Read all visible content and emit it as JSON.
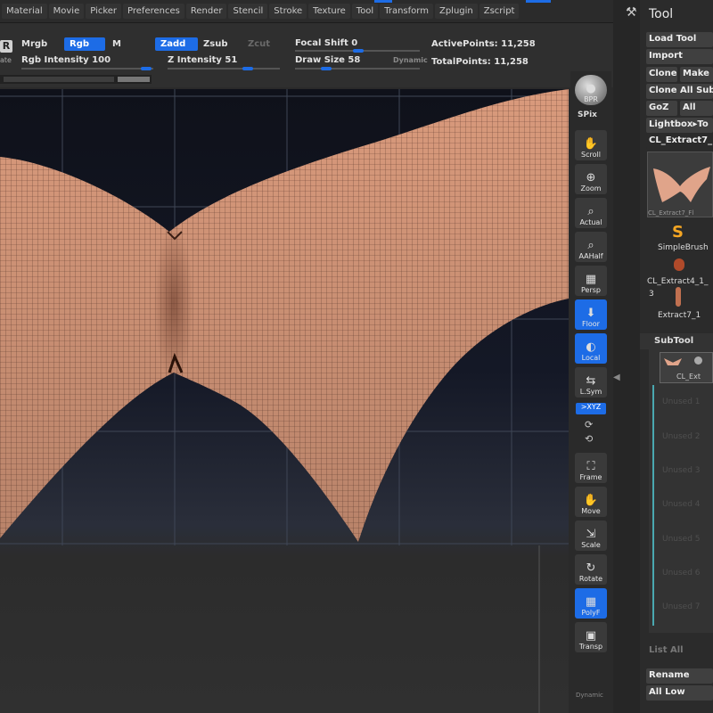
{
  "menu": [
    "Material",
    "Movie",
    "Picker",
    "Preferences",
    "Render",
    "Stencil",
    "Stroke",
    "Texture",
    "Tool",
    "Transform",
    "Zplugin",
    "Zscript"
  ],
  "shelf": {
    "r_icon": "R",
    "r_caption": "ate",
    "mrgb": "Mrgb",
    "rgb": "Rgb",
    "m": "M",
    "zadd": "Zadd",
    "zsub": "Zsub",
    "zcut": "Zcut",
    "rgb_intensity": "Rgb Intensity 100",
    "z_intensity": "Z Intensity 51",
    "focal_shift": "Focal Shift 0",
    "draw_size": "Draw Size 58",
    "dynamic": "Dynamic",
    "active_points": "ActivePoints: 11,258",
    "total_points": "TotalPoints: 11,258"
  },
  "right_shelf": [
    {
      "label": "BPR",
      "icon": "sphere-icon",
      "active": false
    },
    {
      "label": "Scroll",
      "icon": "scroll-icon",
      "active": false
    },
    {
      "label": "Zoom",
      "icon": "zoom-icon",
      "active": false
    },
    {
      "label": "Actual",
      "icon": "actual-icon",
      "active": false
    },
    {
      "label": "AAHalf",
      "icon": "aahalf-icon",
      "active": false
    },
    {
      "label": "Persp",
      "icon": "persp-icon",
      "active": false
    },
    {
      "label": "Floor",
      "icon": "floor-icon",
      "active": true
    },
    {
      "label": "Local",
      "icon": "local-icon",
      "active": true
    },
    {
      "label": "L.Sym",
      "icon": "lsym-icon",
      "active": false
    },
    {
      "label": "Frame",
      "icon": "frame-icon",
      "active": false
    },
    {
      "label": "Move",
      "icon": "move-icon",
      "active": false
    },
    {
      "label": "Scale",
      "icon": "scale-icon",
      "active": false
    },
    {
      "label": "Rotate",
      "icon": "rotate-icon",
      "active": false
    },
    {
      "label": "PolyF",
      "icon": "polyf-icon",
      "active": true
    },
    {
      "label": "Transp",
      "icon": "transp-icon",
      "active": false
    }
  ],
  "spix": "SPix",
  "xyz": ">XYZ",
  "dynamic_bottom": "Dynamic",
  "tool": {
    "title": "Tool",
    "load_tool": "Load Tool",
    "import": "Import",
    "clone": "Clone",
    "make": "Make",
    "clone_all_sub": "Clone All Sub",
    "goz": "GoZ",
    "all": "All",
    "lightbox": "Lightbox▸To",
    "current": "CL_Extract7_",
    "thumb_caption": "CL_Extract7_Fl",
    "simple_brush": "SimpleBrush",
    "extract4": "CL_Extract4_1_",
    "num3": "3",
    "extract7": "Extract7_1",
    "subtool": "SubTool",
    "subtool_item": "CL_Ext",
    "unused": [
      "Unused 1",
      "Unused 2",
      "Unused 3",
      "Unused 4",
      "Unused 5",
      "Unused 6",
      "Unused 7"
    ],
    "list_all": "List All",
    "rename": "Rename",
    "all_low": "All Low"
  },
  "colors": {
    "accent": "#1d6ce6",
    "mesh": "#d99a7c",
    "wire": "#5a3a2c"
  }
}
